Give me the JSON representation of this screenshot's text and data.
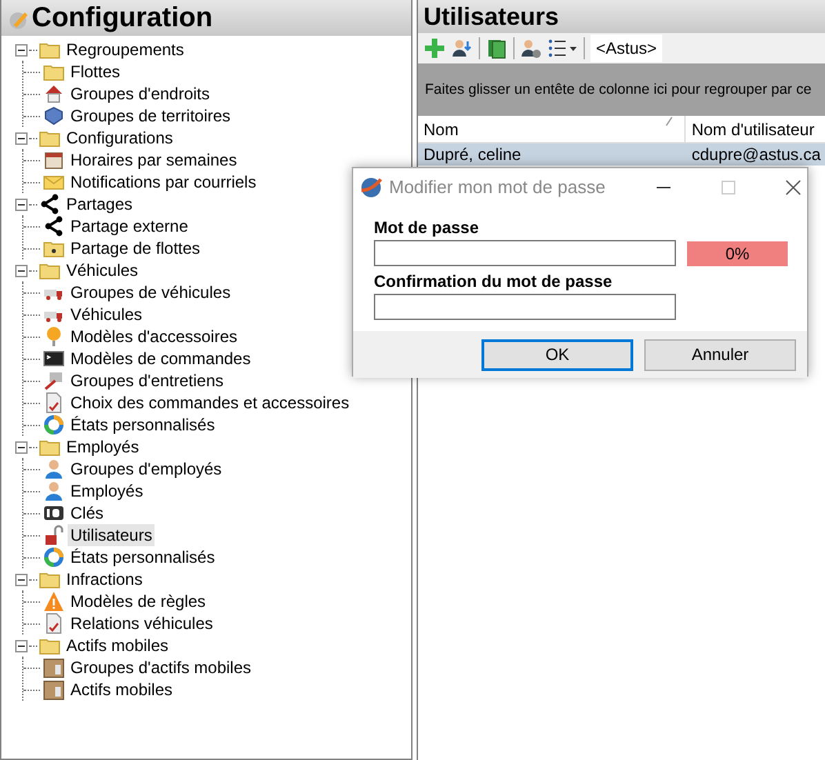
{
  "left_panel": {
    "title": "Configuration",
    "tree": [
      {
        "label": "Regroupements",
        "kind": "folder",
        "expanded": true,
        "selected": false,
        "children": [
          {
            "label": "Flottes",
            "kind": "folder",
            "selected": false
          },
          {
            "label": "Groupes d'endroits",
            "kind": "house",
            "selected": false
          },
          {
            "label": "Groupes de territoires",
            "kind": "shield",
            "selected": false
          }
        ]
      },
      {
        "label": "Configurations",
        "kind": "folder",
        "expanded": true,
        "selected": false,
        "children": [
          {
            "label": "Horaires par semaines",
            "kind": "calendar",
            "selected": false
          },
          {
            "label": "Notifications par courriels",
            "kind": "mail",
            "selected": false
          }
        ]
      },
      {
        "label": "Partages",
        "kind": "share",
        "expanded": true,
        "selected": false,
        "children": [
          {
            "label": "Partage externe",
            "kind": "share",
            "selected": false
          },
          {
            "label": "Partage de flottes",
            "kind": "folder-share",
            "selected": false
          }
        ]
      },
      {
        "label": "Véhicules",
        "kind": "folder",
        "expanded": true,
        "selected": false,
        "children": [
          {
            "label": "Groupes de véhicules",
            "kind": "truck",
            "selected": false
          },
          {
            "label": "Véhicules",
            "kind": "truck",
            "selected": false
          },
          {
            "label": "Modèles d'accessoires",
            "kind": "bulb",
            "selected": false
          },
          {
            "label": "Modèles de commandes",
            "kind": "terminal",
            "selected": false
          },
          {
            "label": "Groupes d'entretiens",
            "kind": "tools",
            "selected": false
          },
          {
            "label": "Choix des commandes et accessoires",
            "kind": "checklist",
            "selected": false
          },
          {
            "label": "États personnalisés",
            "kind": "gauge",
            "selected": false
          }
        ]
      },
      {
        "label": "Employés",
        "kind": "folder",
        "expanded": true,
        "selected": false,
        "children": [
          {
            "label": "Groupes d'employés",
            "kind": "person",
            "selected": false
          },
          {
            "label": "Employés",
            "kind": "person",
            "selected": false
          },
          {
            "label": "Clés",
            "kind": "id",
            "selected": false
          },
          {
            "label": "Utilisateurs",
            "kind": "lock",
            "selected": true
          },
          {
            "label": "États personnalisés",
            "kind": "gauge",
            "selected": false
          }
        ]
      },
      {
        "label": "Infractions",
        "kind": "folder",
        "expanded": true,
        "selected": false,
        "children": [
          {
            "label": "Modèles de règles",
            "kind": "warning",
            "selected": false
          },
          {
            "label": "Relations véhicules",
            "kind": "checklist",
            "selected": false
          }
        ]
      },
      {
        "label": "Actifs mobiles",
        "kind": "folder",
        "expanded": true,
        "selected": false,
        "children": [
          {
            "label": "Groupes d'actifs mobiles",
            "kind": "box",
            "selected": false
          },
          {
            "label": "Actifs mobiles",
            "kind": "box",
            "selected": false
          }
        ]
      }
    ]
  },
  "right_panel": {
    "title": "Utilisateurs",
    "toolbar": {
      "filter": "<Astus>"
    },
    "group_hint": "Faites glisser un entête de colonne ici pour regrouper par ce",
    "columns": [
      "Nom",
      "Nom d'utilisateur"
    ],
    "rows": [
      {
        "cells": [
          "Dupré, celine",
          "cdupre@astus.ca"
        ],
        "selected": true
      }
    ]
  },
  "dialog": {
    "title": "Modifier mon mot de passe",
    "password_label": "Mot de passe",
    "strength": {
      "level": 0,
      "reading": "0%"
    },
    "confirm_label": "Confirmation du mot de passe",
    "buttons": [
      {
        "label": "OK",
        "default": true
      },
      {
        "label": "Annuler",
        "default": false
      }
    ]
  }
}
